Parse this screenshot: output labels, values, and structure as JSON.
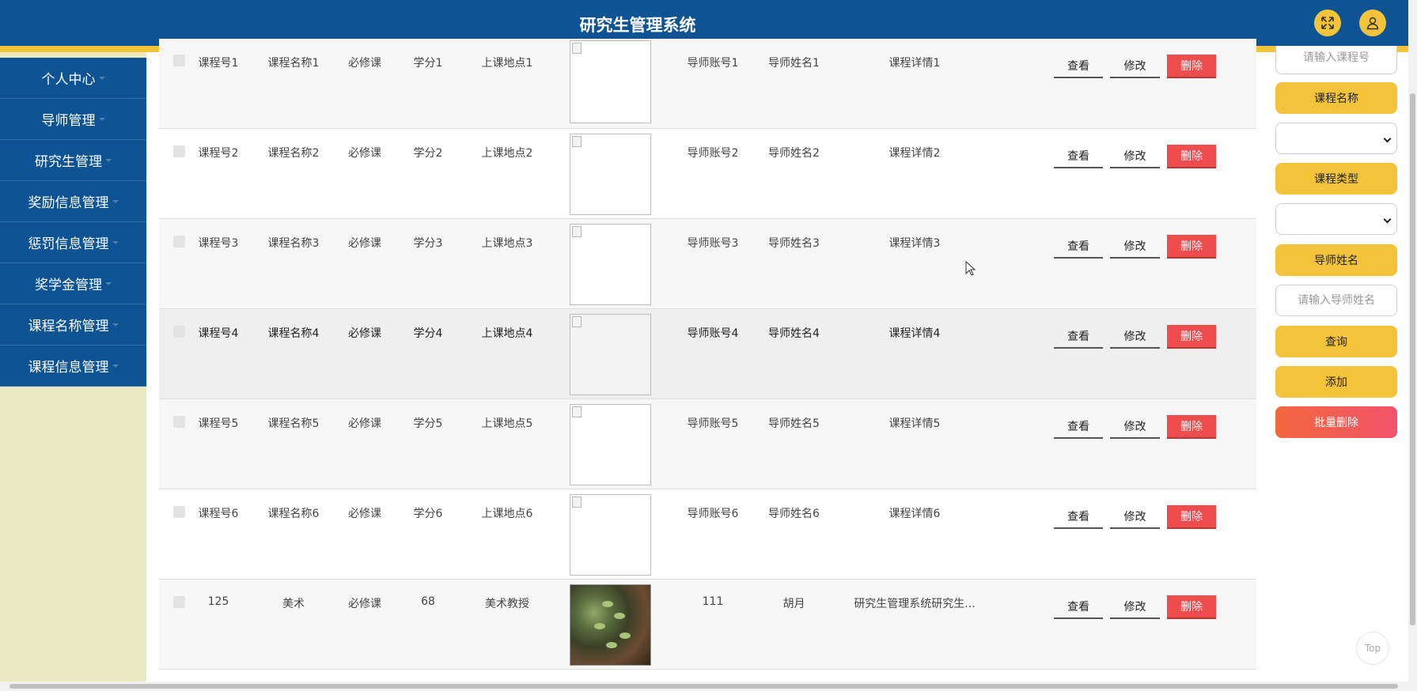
{
  "header": {
    "title": "研究生管理系统"
  },
  "sidebar": {
    "items": [
      {
        "label": "个人中心"
      },
      {
        "label": "导师管理"
      },
      {
        "label": "研究生管理"
      },
      {
        "label": "奖励信息管理"
      },
      {
        "label": "惩罚信息管理"
      },
      {
        "label": "奖学金管理"
      },
      {
        "label": "课程名称管理"
      },
      {
        "label": "课程信息管理"
      }
    ]
  },
  "table": {
    "rows": [
      {
        "course_no": "课程号1",
        "course_name": "课程名称1",
        "type": "必修课",
        "credit": "学分1",
        "location": "上课地点1",
        "tutor_account": "导师账号1",
        "tutor_name": "导师姓名1",
        "detail": "课程详情1"
      },
      {
        "course_no": "课程号2",
        "course_name": "课程名称2",
        "type": "必修课",
        "credit": "学分2",
        "location": "上课地点2",
        "tutor_account": "导师账号2",
        "tutor_name": "导师姓名2",
        "detail": "课程详情2"
      },
      {
        "course_no": "课程号3",
        "course_name": "课程名称3",
        "type": "必修课",
        "credit": "学分3",
        "location": "上课地点3",
        "tutor_account": "导师账号3",
        "tutor_name": "导师姓名3",
        "detail": "课程详情3"
      },
      {
        "course_no": "课程号4",
        "course_name": "课程名称4",
        "type": "必修课",
        "credit": "学分4",
        "location": "上课地点4",
        "tutor_account": "导师账号4",
        "tutor_name": "导师姓名4",
        "detail": "课程详情4"
      },
      {
        "course_no": "课程号5",
        "course_name": "课程名称5",
        "type": "必修课",
        "credit": "学分5",
        "location": "上课地点5",
        "tutor_account": "导师账号5",
        "tutor_name": "导师姓名5",
        "detail": "课程详情5"
      },
      {
        "course_no": "课程号6",
        "course_name": "课程名称6",
        "type": "必修课",
        "credit": "学分6",
        "location": "上课地点6",
        "tutor_account": "导师账号6",
        "tutor_name": "导师姓名6",
        "detail": "课程详情6"
      },
      {
        "course_no": "125",
        "course_name": "美术",
        "type": "必修课",
        "credit": "68",
        "location": "美术教授",
        "tutor_account": "111",
        "tutor_name": "胡月",
        "detail": "研究生管理系统研究生..."
      }
    ],
    "actions": {
      "view": "查看",
      "edit": "修改",
      "delete": "删除"
    }
  },
  "search": {
    "course_no_placeholder": "请输入课程号",
    "course_name_label": "课程名称",
    "course_type_label": "课程类型",
    "tutor_name_label": "导师姓名",
    "tutor_name_placeholder": "请输入导师姓名",
    "query_button": "查询",
    "add_button": "添加",
    "batch_delete_button": "批量删除"
  },
  "top_button": "Top"
}
